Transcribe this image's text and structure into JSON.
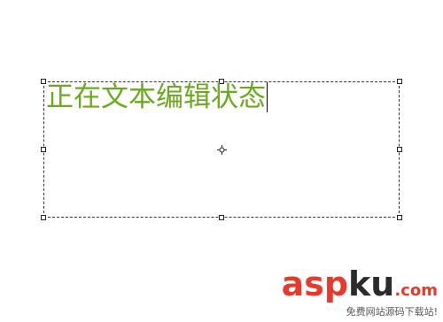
{
  "editor": {
    "text_box": {
      "text": "正在文本编辑状态",
      "text_color": "#6aaa1e",
      "state": "editing"
    }
  },
  "watermark": {
    "brand_asp": "asp",
    "brand_ku": "ku",
    "brand_com": ".com",
    "subtitle": "免费网站源码下载站!",
    "accent_color": "#e83a2a"
  }
}
